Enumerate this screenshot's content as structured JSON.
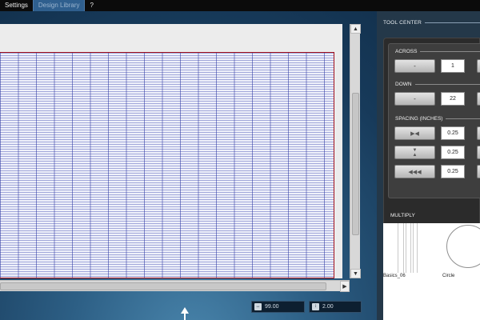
{
  "menubar": {
    "items": [
      {
        "label": "Settings",
        "active": false
      },
      {
        "label": "Design Library",
        "active": true
      },
      {
        "label": "?",
        "active": false
      }
    ]
  },
  "canvas": {
    "grid_line_color": "#2832a0",
    "grid_border_color": "#a3101a"
  },
  "readouts": {
    "width_value": "99.00",
    "height_value": "2.00",
    "width_icon": "horizontal-resize-icon",
    "height_icon": "vertical-resize-icon"
  },
  "tool_center": {
    "title": "TOOL CENTER",
    "across_label": "ACROSS",
    "across_minus": "-",
    "across_value": "1",
    "down_label": "DOWN",
    "down_minus": "-",
    "down_value": "22",
    "spacing_label": "SPACING (INCHES)",
    "spacing_rows": [
      {
        "icon": "horizontal-spacing-icon",
        "value": "0.25"
      },
      {
        "icon": "vertical-spacing-icon",
        "value": "0.25"
      },
      {
        "icon": "nudge-left-icon",
        "value": "0.25"
      }
    ],
    "multiply_label": "MULTIPLY"
  },
  "library": {
    "items": [
      {
        "label": "Basics_06"
      },
      {
        "label": "Circle"
      }
    ]
  }
}
